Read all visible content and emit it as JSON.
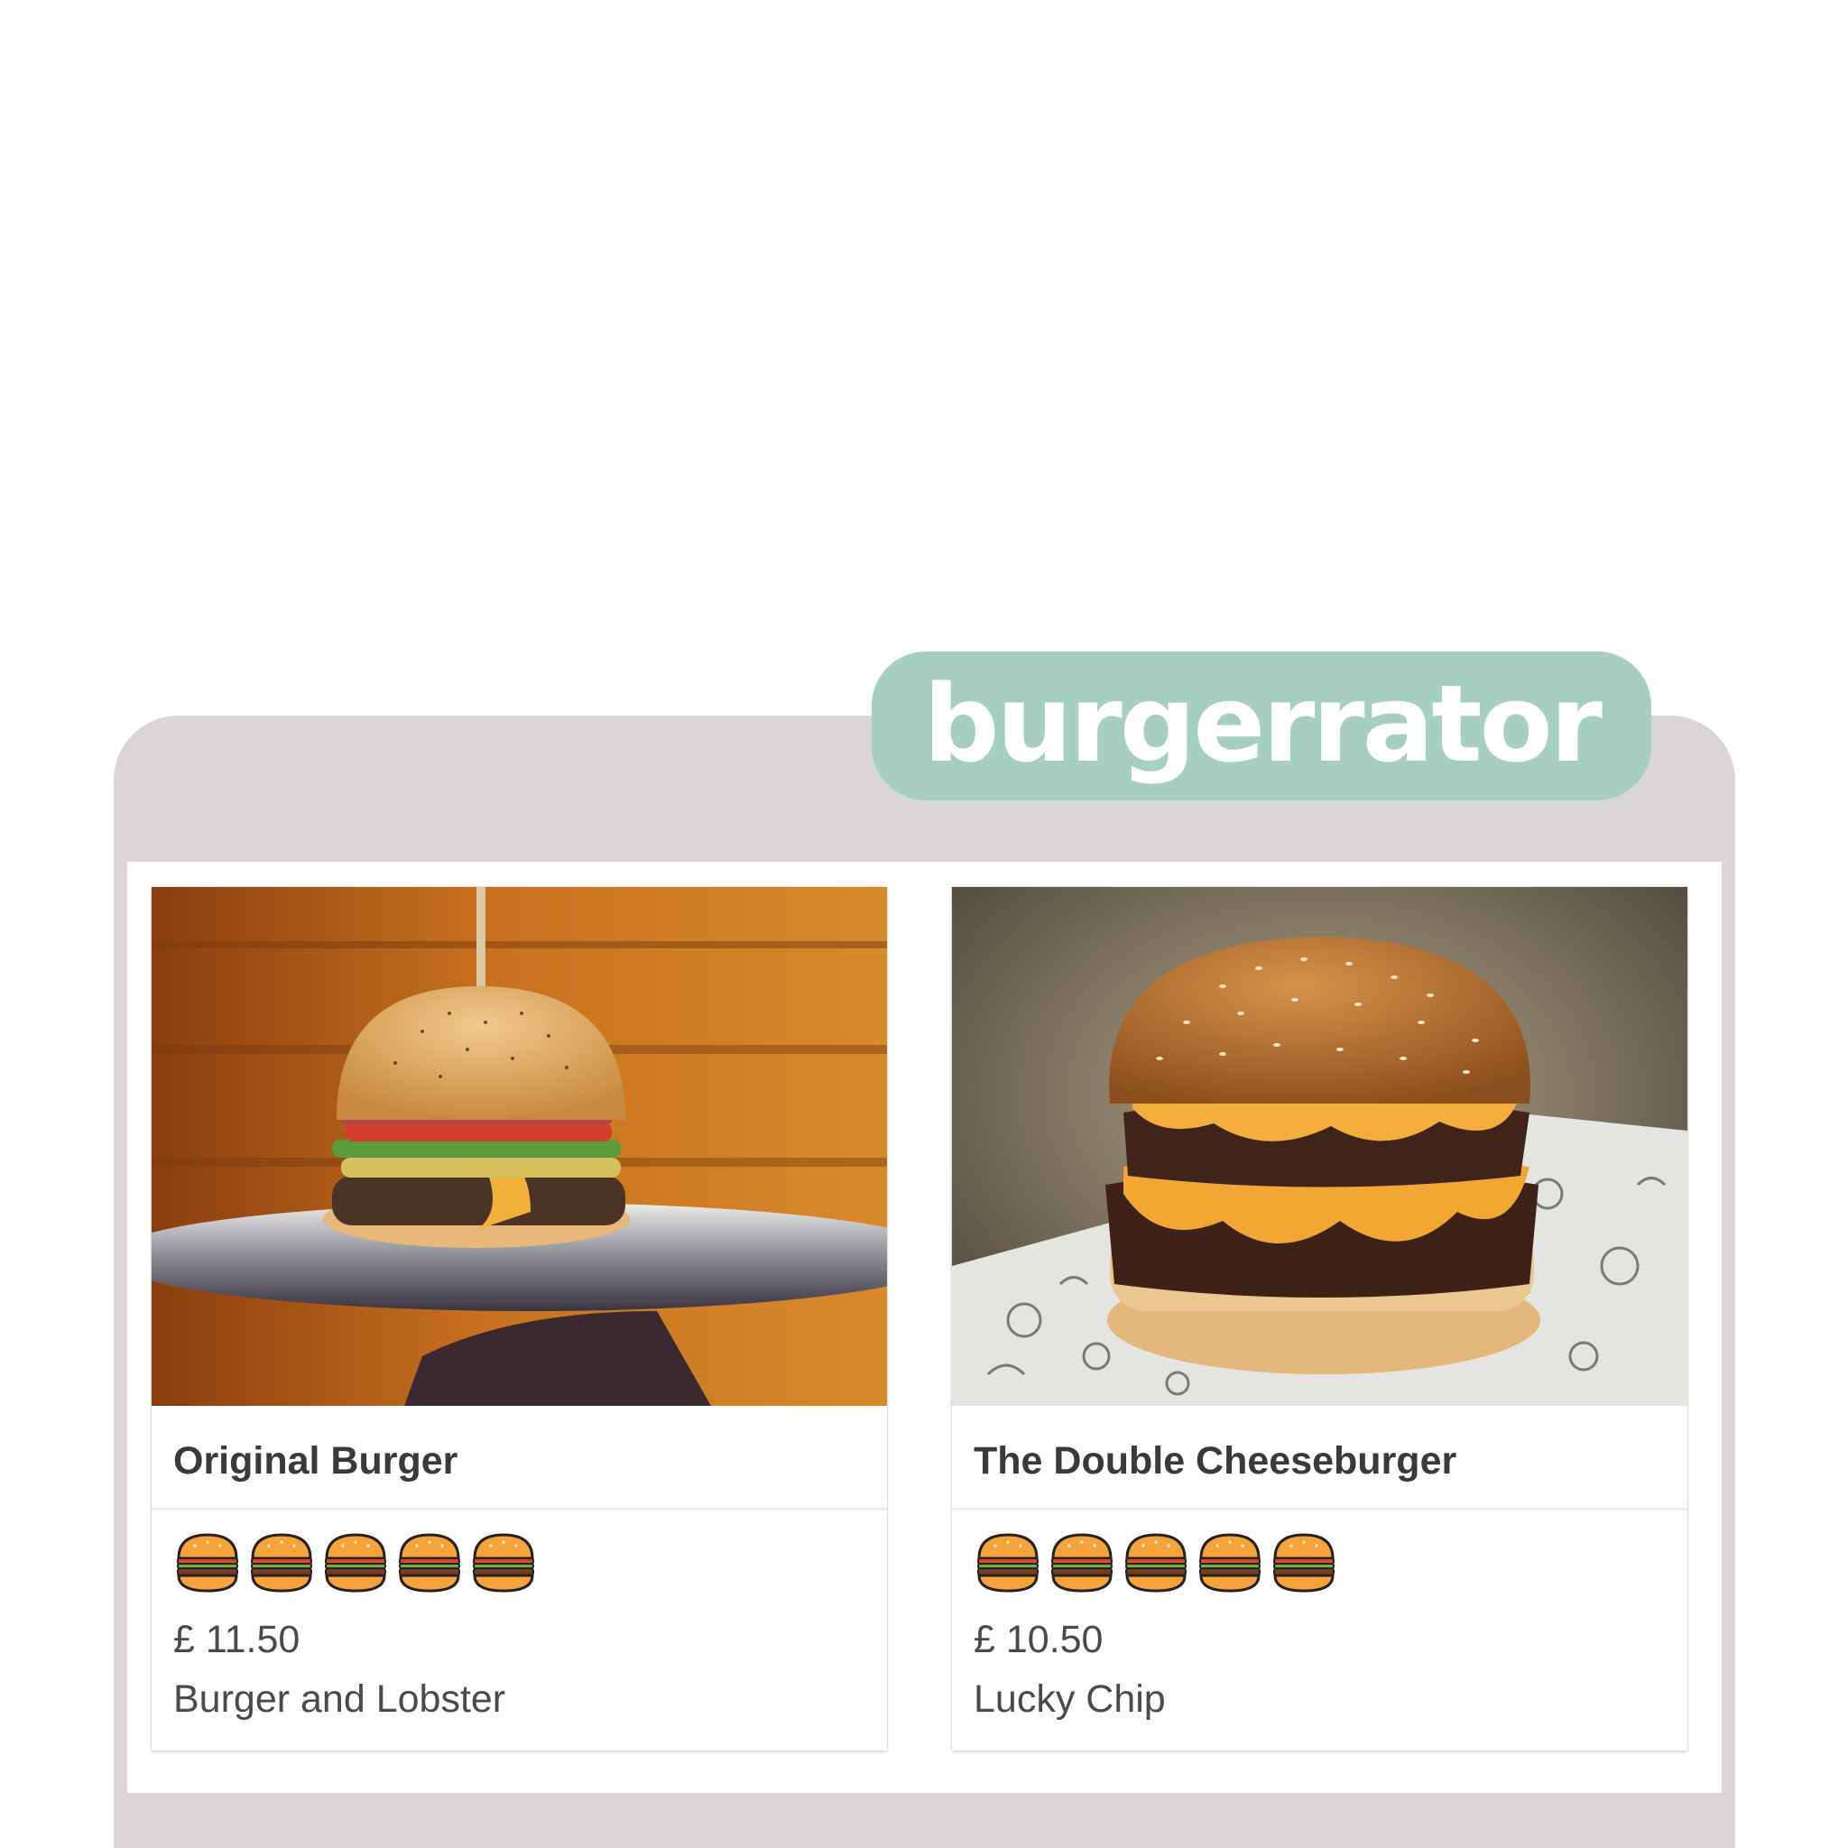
{
  "app": {
    "logo_text": "burgerrator"
  },
  "burgers": [
    {
      "name": "Original Burger",
      "rating": 5,
      "rating_max": 5,
      "price": "£ 11.50",
      "restaurant": "Burger and Lobster"
    },
    {
      "name": "The Double Cheeseburger",
      "rating": 5,
      "rating_max": 5,
      "price": "£ 10.50",
      "restaurant": "Lucky Chip"
    }
  ],
  "colors": {
    "brand_pill": "#a6cfc0",
    "frame": "#d9d6d5",
    "text": "#3a3a3a"
  },
  "icons": {
    "rating": "burger-icon"
  }
}
